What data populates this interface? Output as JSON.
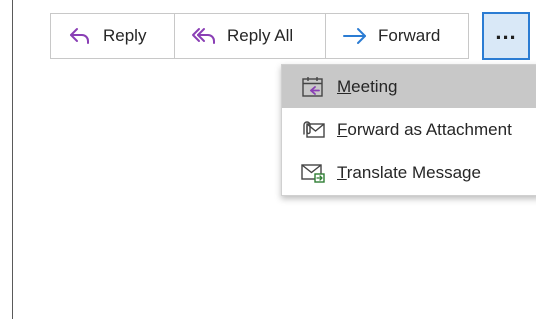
{
  "toolbar": {
    "reply_label": "Reply",
    "reply_all_label": "Reply All",
    "forward_label": "Forward",
    "more_label": "..."
  },
  "menu": {
    "items": [
      {
        "accel": "M",
        "rest": "eeting",
        "icon": "meeting-calendar-icon",
        "highlighted": true
      },
      {
        "accel": "F",
        "rest": "orward as Attachment",
        "icon": "forward-attachment-icon",
        "highlighted": false
      },
      {
        "accel": "T",
        "rest": "ranslate Message",
        "icon": "translate-message-icon",
        "highlighted": false
      }
    ]
  },
  "colors": {
    "reply_icon": "#8a3fb5",
    "forward_icon": "#2b7cd3",
    "more_border": "#2b7cd3",
    "more_bg": "#d9e8f7",
    "menu_highlight": "#c8c8c8"
  }
}
